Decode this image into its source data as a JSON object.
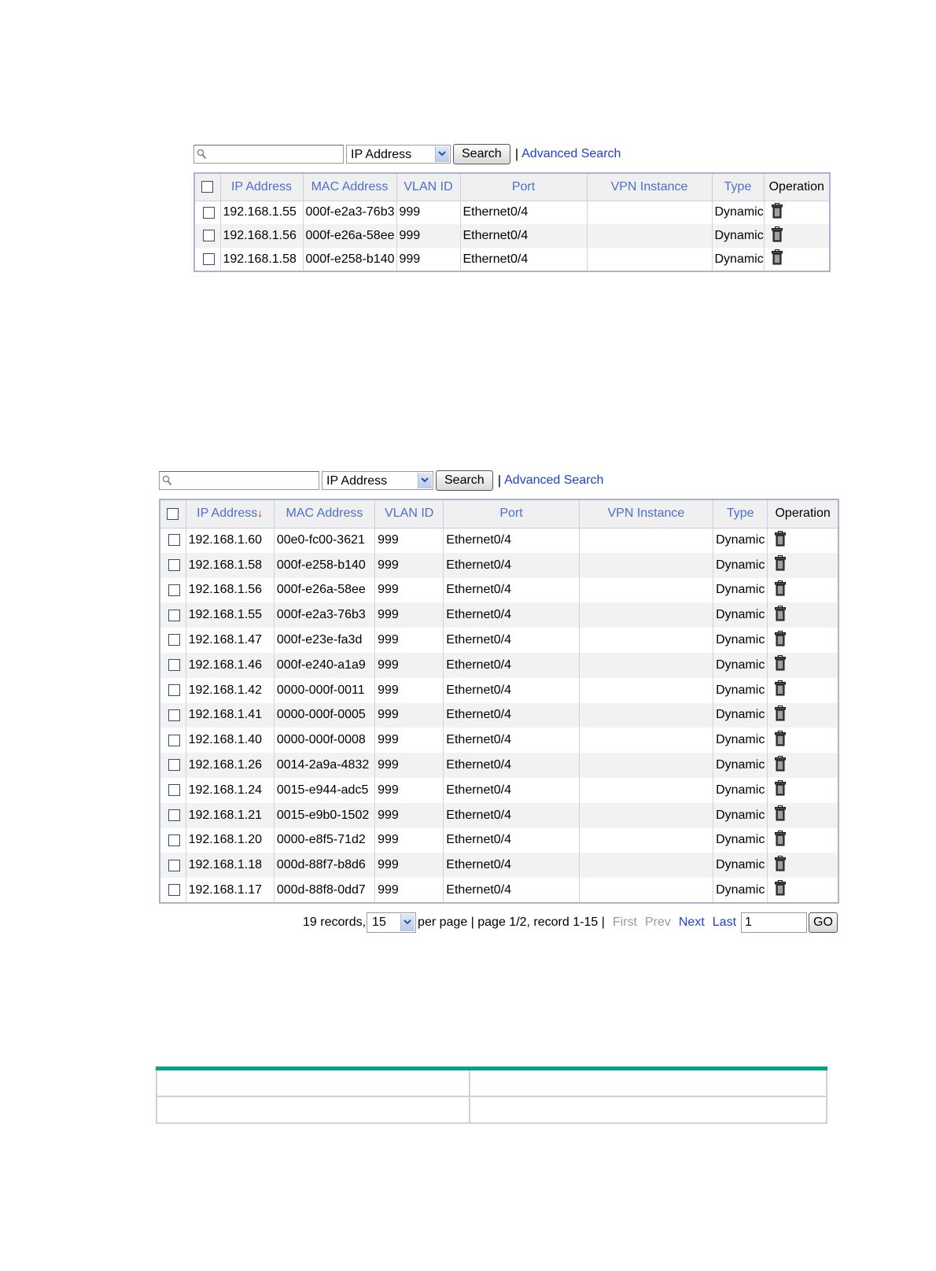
{
  "panel1": {
    "search": {
      "placeholder": "",
      "field": "IP Address",
      "button": "Search",
      "separator": "|",
      "advanced": "Advanced Search"
    },
    "columns": [
      "IP Address",
      "MAC Address",
      "VLAN ID",
      "Port",
      "VPN Instance",
      "Type",
      "Operation"
    ],
    "rows": [
      {
        "ip": "192.168.1.55",
        "mac": "000f-e2a3-76b3",
        "vlan": "999",
        "port": "Ethernet0/4",
        "vpn": "",
        "type": "Dynamic"
      },
      {
        "ip": "192.168.1.56",
        "mac": "000f-e26a-58ee",
        "vlan": "999",
        "port": "Ethernet0/4",
        "vpn": "",
        "type": "Dynamic"
      },
      {
        "ip": "192.168.1.58",
        "mac": "000f-e258-b140",
        "vlan": "999",
        "port": "Ethernet0/4",
        "vpn": "",
        "type": "Dynamic"
      }
    ]
  },
  "panel2": {
    "search": {
      "placeholder": "",
      "field": "IP Address",
      "button": "Search",
      "separator": "|",
      "advanced": "Advanced Search"
    },
    "columns": [
      "IP Address",
      "MAC Address",
      "VLAN ID",
      "Port",
      "VPN Instance",
      "Type",
      "Operation"
    ],
    "sort_indicator": "↓",
    "rows": [
      {
        "ip": "192.168.1.60",
        "mac": "00e0-fc00-3621",
        "vlan": "999",
        "port": "Ethernet0/4",
        "vpn": "",
        "type": "Dynamic"
      },
      {
        "ip": "192.168.1.58",
        "mac": "000f-e258-b140",
        "vlan": "999",
        "port": "Ethernet0/4",
        "vpn": "",
        "type": "Dynamic"
      },
      {
        "ip": "192.168.1.56",
        "mac": "000f-e26a-58ee",
        "vlan": "999",
        "port": "Ethernet0/4",
        "vpn": "",
        "type": "Dynamic"
      },
      {
        "ip": "192.168.1.55",
        "mac": "000f-e2a3-76b3",
        "vlan": "999",
        "port": "Ethernet0/4",
        "vpn": "",
        "type": "Dynamic"
      },
      {
        "ip": "192.168.1.47",
        "mac": "000f-e23e-fa3d",
        "vlan": "999",
        "port": "Ethernet0/4",
        "vpn": "",
        "type": "Dynamic"
      },
      {
        "ip": "192.168.1.46",
        "mac": "000f-e240-a1a9",
        "vlan": "999",
        "port": "Ethernet0/4",
        "vpn": "",
        "type": "Dynamic"
      },
      {
        "ip": "192.168.1.42",
        "mac": "0000-000f-0011",
        "vlan": "999",
        "port": "Ethernet0/4",
        "vpn": "",
        "type": "Dynamic"
      },
      {
        "ip": "192.168.1.41",
        "mac": "0000-000f-0005",
        "vlan": "999",
        "port": "Ethernet0/4",
        "vpn": "",
        "type": "Dynamic"
      },
      {
        "ip": "192.168.1.40",
        "mac": "0000-000f-0008",
        "vlan": "999",
        "port": "Ethernet0/4",
        "vpn": "",
        "type": "Dynamic"
      },
      {
        "ip": "192.168.1.26",
        "mac": "0014-2a9a-4832",
        "vlan": "999",
        "port": "Ethernet0/4",
        "vpn": "",
        "type": "Dynamic"
      },
      {
        "ip": "192.168.1.24",
        "mac": "0015-e944-adc5",
        "vlan": "999",
        "port": "Ethernet0/4",
        "vpn": "",
        "type": "Dynamic"
      },
      {
        "ip": "192.168.1.21",
        "mac": "0015-e9b0-1502",
        "vlan": "999",
        "port": "Ethernet0/4",
        "vpn": "",
        "type": "Dynamic"
      },
      {
        "ip": "192.168.1.20",
        "mac": "0000-e8f5-71d2",
        "vlan": "999",
        "port": "Ethernet0/4",
        "vpn": "",
        "type": "Dynamic"
      },
      {
        "ip": "192.168.1.18",
        "mac": "000d-88f7-b8d6",
        "vlan": "999",
        "port": "Ethernet0/4",
        "vpn": "",
        "type": "Dynamic"
      },
      {
        "ip": "192.168.1.17",
        "mac": "000d-88f8-0dd7",
        "vlan": "999",
        "port": "Ethernet0/4",
        "vpn": "",
        "type": "Dynamic"
      }
    ],
    "pager": {
      "records": "19 records,",
      "per_page_value": "15",
      "per_page_text": "per page | page 1/2, record 1-15 |",
      "first": "First",
      "prev": "Prev",
      "next": "Next",
      "last": "Last",
      "page_input": "1",
      "go": "GO"
    }
  },
  "colors": {
    "header_text": "#4a6fd0",
    "link": "#1f3fcf",
    "accent_rule": "#00a489",
    "alt_row": "#f2f2f2"
  },
  "icons": [
    "magnifier-icon",
    "dropdown-arrow-icon",
    "trash-icon",
    "sort-down-arrow-icon"
  ]
}
